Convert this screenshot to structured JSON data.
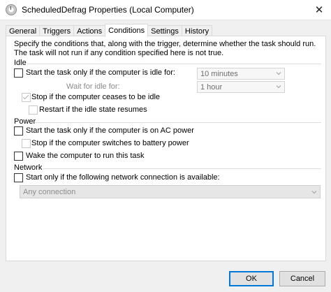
{
  "window": {
    "title": "ScheduledDefrag Properties (Local Computer)",
    "close_glyph": "✕"
  },
  "tabs": [
    {
      "label": "General"
    },
    {
      "label": "Triggers"
    },
    {
      "label": "Actions"
    },
    {
      "label": "Conditions",
      "active": true
    },
    {
      "label": "Settings"
    },
    {
      "label": "History"
    }
  ],
  "description": "Specify the conditions that, along with the trigger, determine whether the task should run.  The task will not run  if any condition specified here is not true.",
  "idle": {
    "group_label": "Idle",
    "start_idle": {
      "label": "Start the task only if the computer is idle for:",
      "checked": false
    },
    "idle_duration": {
      "value": "10 minutes"
    },
    "wait_label": "Wait for idle for:",
    "wait_duration": {
      "value": "1 hour"
    },
    "stop_if_not_idle": {
      "label": "Stop if the computer ceases to be idle",
      "checked": true
    },
    "restart_if_idle": {
      "label": "Restart if the idle state resumes",
      "checked": false
    }
  },
  "power": {
    "group_label": "Power",
    "ac_only": {
      "label": "Start the task only if the computer is on AC power",
      "checked": false
    },
    "stop_on_battery": {
      "label": "Stop if the computer switches to battery power",
      "checked": false
    },
    "wake": {
      "label": "Wake the computer to run this task",
      "checked": false
    }
  },
  "network": {
    "group_label": "Network",
    "start_if_network": {
      "label": "Start only if the following network connection is available:",
      "checked": false
    },
    "connection": {
      "value": "Any connection"
    }
  },
  "buttons": {
    "ok": "OK",
    "cancel": "Cancel"
  },
  "colors": {
    "accent": "#0078d7",
    "window_bg": "#f0f0f0",
    "panel_bg": "#ffffff",
    "disabled_text": "#8a8a8a"
  }
}
